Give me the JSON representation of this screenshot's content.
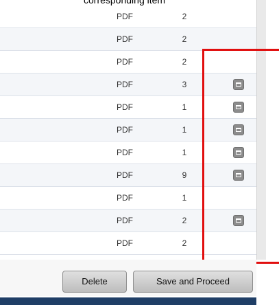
{
  "partial_title": "corresponding item",
  "rows": [
    {
      "type": "PDF",
      "count": "2",
      "has_icon": false
    },
    {
      "type": "PDF",
      "count": "2",
      "has_icon": false
    },
    {
      "type": "PDF",
      "count": "2",
      "has_icon": false
    },
    {
      "type": "PDF",
      "count": "3",
      "has_icon": true
    },
    {
      "type": "PDF",
      "count": "1",
      "has_icon": true
    },
    {
      "type": "PDF",
      "count": "1",
      "has_icon": true
    },
    {
      "type": "PDF",
      "count": "1",
      "has_icon": true
    },
    {
      "type": "PDF",
      "count": "9",
      "has_icon": true
    },
    {
      "type": "PDF",
      "count": "1",
      "has_icon": false
    },
    {
      "type": "PDF",
      "count": "2",
      "has_icon": true
    },
    {
      "type": "PDF",
      "count": "2",
      "has_icon": false
    }
  ],
  "buttons": {
    "delete": "Delete",
    "save_and_proceed": "Save and Proceed"
  },
  "colors": {
    "annotation_red": "#e10f0f",
    "footer_navy": "#1f3e66",
    "button_gray": "#8c8c8c"
  },
  "icons": {
    "row_action": "window-icon"
  }
}
